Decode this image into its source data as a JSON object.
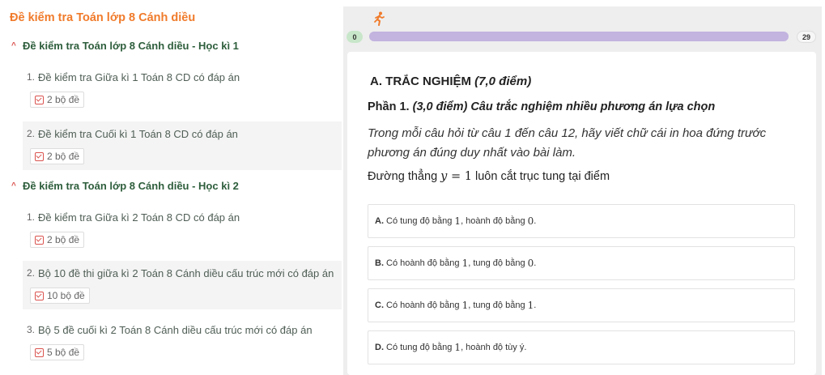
{
  "left": {
    "title": "Đề kiểm tra Toán lớp 8 Cánh diều",
    "sections": [
      {
        "label": "Đề kiểm tra Toán lớp 8 Cánh diều - Học kì 1",
        "items": [
          {
            "num": "1.",
            "text": "Đề kiểm tra Giữa kì 1 Toán 8 CD có đáp án",
            "badge": "2 bộ đề"
          },
          {
            "num": "2.",
            "text": "Đề kiểm tra Cuối kì 1 Toán 8 CD có đáp án",
            "badge": "2 bộ đề"
          }
        ]
      },
      {
        "label": "Đề kiểm tra Toán lớp 8 Cánh diều - Học kì 2",
        "items": [
          {
            "num": "1.",
            "text": "Đề kiểm tra Giữa kì 2 Toán 8 CD có đáp án",
            "badge": "2 bộ đề"
          },
          {
            "num": "2.",
            "text": "Bộ 10 đề thi giữa kì 2 Toán 8 Cánh diều cấu trúc mới có đáp án",
            "badge": "10 bộ đề"
          },
          {
            "num": "3.",
            "text": "Bộ 5 đề cuối kì 2 Toán 8 Cánh diều cấu trúc mới có đáp án",
            "badge": "5 bộ đề"
          }
        ]
      }
    ]
  },
  "progress": {
    "start": "0",
    "end": "29",
    "runner_icon": "running-person-icon",
    "track_color": "#c2b3df"
  },
  "quiz": {
    "heading_a": "A. TRẮC NGHIỆM",
    "heading_a_points": "(7,0 điểm)",
    "part1_label": "Phần 1.",
    "part1_desc": "(3,0 điểm) Câu trắc nghiệm nhiều phương án lựa chọn",
    "instruction": "Trong mỗi câu hỏi từ câu 1 đến câu 12, hãy viết chữ cái in hoa đứng trước phương án đúng duy nhất vào bài làm.",
    "question_pre": "Đường thẳng",
    "question_var": "y",
    "question_eq": " = 1",
    "question_post": "luôn cắt trục tung tại điểm",
    "options": [
      {
        "letter": "A.",
        "p1": "Có tung độ bằng",
        "n1": "1",
        "p2": ", hoành độ bằng",
        "n2": "0",
        "p3": "."
      },
      {
        "letter": "B.",
        "p1": "Có hoành độ bằng",
        "n1": "1",
        "p2": ", tung độ bằng",
        "n2": "0",
        "p3": "."
      },
      {
        "letter": "C.",
        "p1": "Có hoành độ bằng",
        "n1": "1",
        "p2": ", tung độ bằng",
        "n2": "1",
        "p3": "."
      },
      {
        "letter": "D.",
        "p1": "Có tung độ bằng",
        "n1": "1",
        "p2": ", hoành độ tùy ý.",
        "n2": "",
        "p3": ""
      }
    ]
  }
}
